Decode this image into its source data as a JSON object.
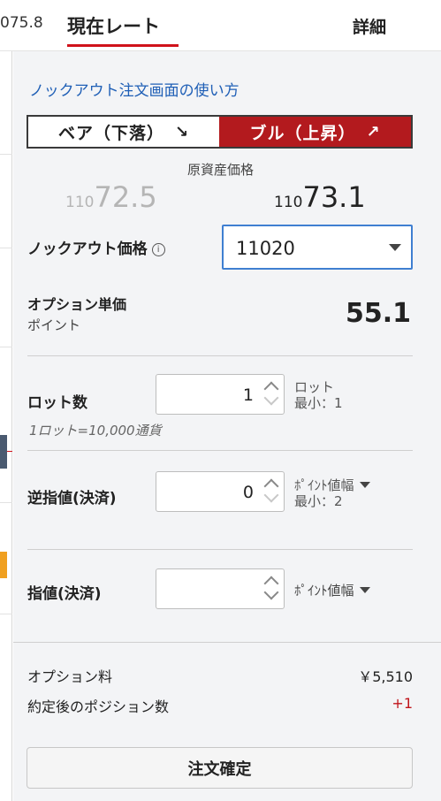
{
  "header": {
    "prev_rate_fragment": "075.8",
    "tab_current": "現在レート",
    "tab_detail": "詳細",
    "accent_color": "#d0121b"
  },
  "order": {
    "howto_link": "ノックアウト注文画面の使い方",
    "side": {
      "bear_label": "ベア（下落）",
      "bear_arrow": "↘",
      "bull_label": "ブル（上昇）",
      "bull_arrow": "↗",
      "selected": "bull",
      "bull_color": "#b31a1e"
    },
    "underlying": {
      "label": "原資産価格",
      "bid_prefix": "110",
      "bid_main": "72.5",
      "ask_prefix": "110",
      "ask_main": "73.1"
    },
    "knockout": {
      "label": "ノックアウト価格",
      "info_icon": "info-icon",
      "value": "11020"
    },
    "option_price": {
      "label": "オプション単価",
      "sub": "ポイント",
      "value": "55.1"
    },
    "lots": {
      "label": "ロット数",
      "value": "1",
      "unit": "ロット",
      "min": "最小：1",
      "note": "1ロット=10,000通貨"
    },
    "stop": {
      "label": "逆指値(決済)",
      "value": "0",
      "unit": "ﾎﾟｲﾝﾄ値幅",
      "min": "最小：2"
    },
    "limit": {
      "label": "指値(決済)",
      "value": "",
      "unit": "ﾎﾟｲﾝﾄ値幅"
    },
    "summary": {
      "premium_label": "オプション料",
      "premium_value": "￥5,510",
      "positions_label": "約定後のポジション数",
      "positions_value": "+1"
    },
    "submit_label": "注文確定"
  }
}
